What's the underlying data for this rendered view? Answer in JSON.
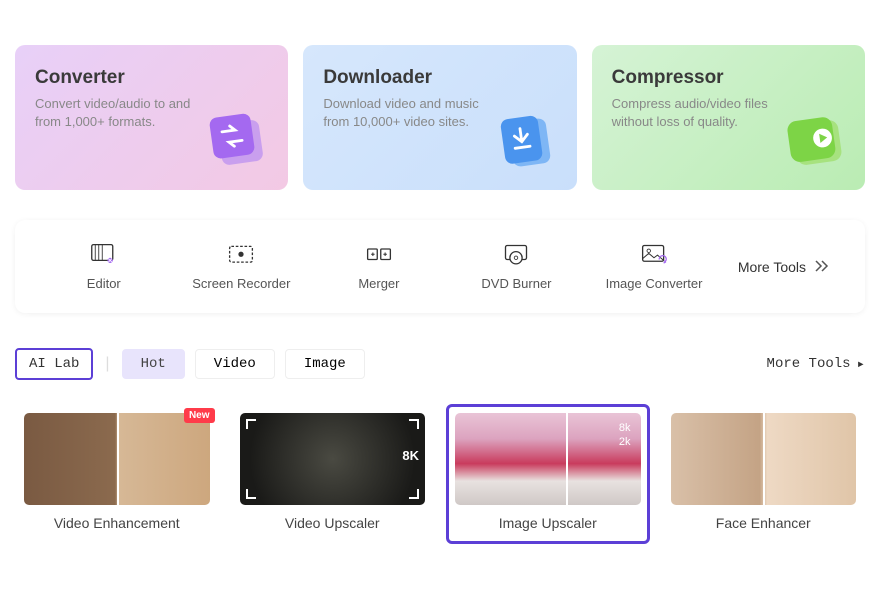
{
  "hero": [
    {
      "title": "Converter",
      "desc": "Convert video/audio to and from 1,000+ formats."
    },
    {
      "title": "Downloader",
      "desc": "Download video and music from 10,000+ video sites."
    },
    {
      "title": "Compressor",
      "desc": "Compress audio/video files without loss of quality."
    }
  ],
  "tools": [
    {
      "label": "Editor"
    },
    {
      "label": "Screen Recorder"
    },
    {
      "label": "Merger"
    },
    {
      "label": "DVD Burner"
    },
    {
      "label": "Image Converter"
    }
  ],
  "tools_more": "More Tools",
  "tabs": {
    "ailab": "AI Lab",
    "hot": "Hot",
    "video": "Video",
    "image": "Image"
  },
  "more_tools_right": "More Tools",
  "features": [
    {
      "label": "Video Enhancement",
      "badge": "New"
    },
    {
      "label": "Video Upscaler",
      "tag": "8K"
    },
    {
      "label": "Image Upscaler",
      "tag1": "8k",
      "tag2": "2k"
    },
    {
      "label": "Face Enhancer"
    }
  ]
}
